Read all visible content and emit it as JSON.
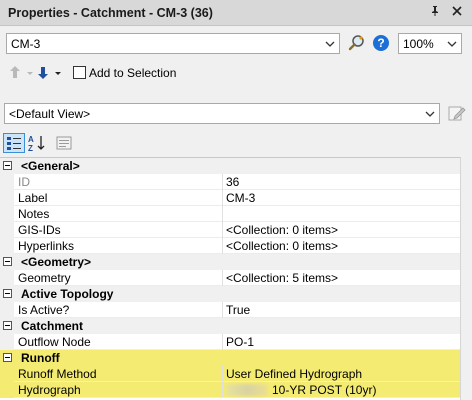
{
  "window": {
    "title": "Properties - Catchment - CM-3 (36)"
  },
  "toolbar": {
    "element_select_value": "CM-3",
    "zoom_value": "100%",
    "add_to_selection_label": "Add to Selection",
    "add_to_selection_checked": false
  },
  "view": {
    "selected": "<Default View>"
  },
  "grid": {
    "categories": [
      {
        "label": "<General>"
      },
      {
        "label": "<Geometry>"
      },
      {
        "label": "Active Topology"
      },
      {
        "label": "Catchment"
      },
      {
        "label": "Runoff"
      }
    ],
    "general": [
      {
        "name": "ID",
        "value": "36"
      },
      {
        "name": "Label",
        "value": "CM-3"
      },
      {
        "name": "Notes",
        "value": ""
      },
      {
        "name": "GIS-IDs",
        "value": "<Collection: 0 items>"
      },
      {
        "name": "Hyperlinks",
        "value": "<Collection: 0 items>"
      }
    ],
    "geometry": [
      {
        "name": "Geometry",
        "value": "<Collection: 5 items>"
      }
    ],
    "topology": [
      {
        "name": "Is Active?",
        "value": "True"
      }
    ],
    "catchment": [
      {
        "name": "Outflow Node",
        "value": "PO-1"
      }
    ],
    "runoff": [
      {
        "name": "Runoff Method",
        "value": "User Defined Hydrograph"
      },
      {
        "name": "Hydrograph",
        "value": "10-YR POST (10yr)"
      }
    ]
  },
  "colors": {
    "highlight": "#f4ec72",
    "help_icon": "#1c6fd6"
  }
}
